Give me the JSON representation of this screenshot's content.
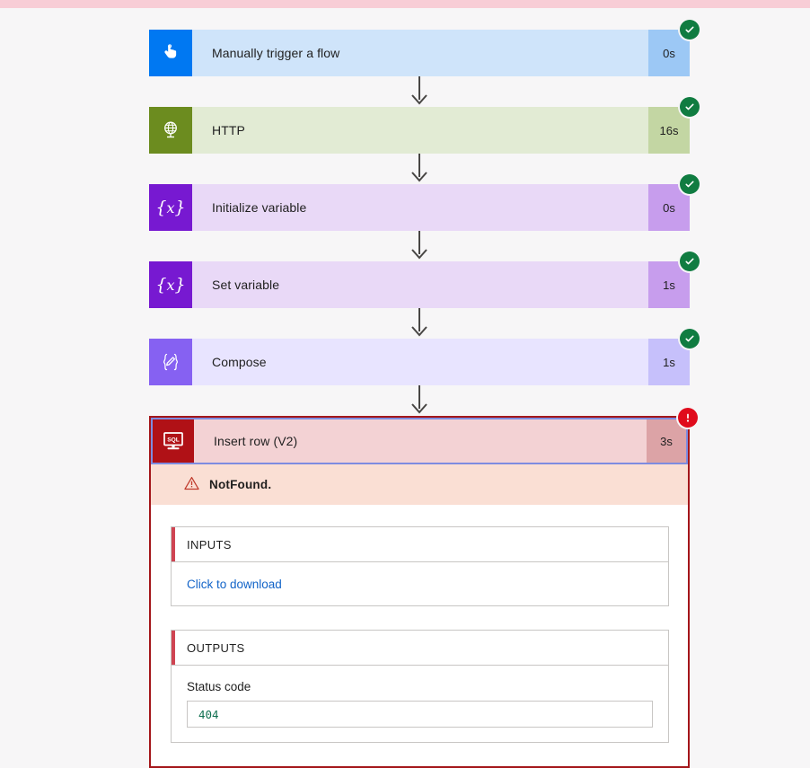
{
  "page": {
    "background_color": "#f7f6f7",
    "banner_color": "#f8cdd6"
  },
  "flow": {
    "steps": [
      {
        "title": "Manually trigger a flow",
        "duration": "0s",
        "status": "succeeded",
        "status_icon": "check-circle-icon",
        "icon": "tap-hand-icon",
        "icon_bg": "#0078f2",
        "row_bg": "#cfe4fa",
        "duration_bg": "#9cc8f5"
      },
      {
        "title": "HTTP",
        "duration": "16s",
        "status": "succeeded",
        "status_icon": "check-circle-icon",
        "icon": "globe-icon",
        "icon_bg": "#6c8c1f",
        "row_bg": "#e2ebd4",
        "duration_bg": "#c3d6a3"
      },
      {
        "title": "Initialize variable",
        "duration": "0s",
        "status": "succeeded",
        "status_icon": "check-circle-icon",
        "icon": "variable-braces-icon",
        "icon_bg": "#7719d1",
        "row_bg": "#e9d9f7",
        "duration_bg": "#c79ded"
      },
      {
        "title": "Set variable",
        "duration": "1s",
        "status": "succeeded",
        "status_icon": "check-circle-icon",
        "icon": "variable-braces-icon",
        "icon_bg": "#7719d1",
        "row_bg": "#e9d9f7",
        "duration_bg": "#c79ded"
      },
      {
        "title": "Compose",
        "duration": "1s",
        "status": "succeeded",
        "status_icon": "check-circle-icon",
        "icon": "compose-pencil-braces-icon",
        "icon_bg": "#8661f2",
        "row_bg": "#e8e4ff",
        "duration_bg": "#c6c0fb"
      }
    ],
    "failed_step": {
      "title": "Insert row (V2)",
      "duration": "3s",
      "status": "failed",
      "status_icon": "error-exclamation-icon",
      "icon": "sql-monitor-icon",
      "icon_bg": "#b01116",
      "row_bg": "#f3d2d4",
      "duration_bg": "#dca3a6",
      "border_color": "#a4161a",
      "error": {
        "icon": "warning-triangle-icon",
        "message": "NotFound.",
        "bar_bg": "#fadfd4"
      },
      "inputs": {
        "header": "INPUTS",
        "download_link": "Click to download",
        "accent_color": "#cf4452"
      },
      "outputs": {
        "header": "OUTPUTS",
        "accent_color": "#cf4452",
        "fields": [
          {
            "label": "Status code",
            "value": "404",
            "value_color": "#107050"
          }
        ]
      }
    }
  },
  "status_colors": {
    "success": "#107c41",
    "failure": "#e00b1c"
  }
}
